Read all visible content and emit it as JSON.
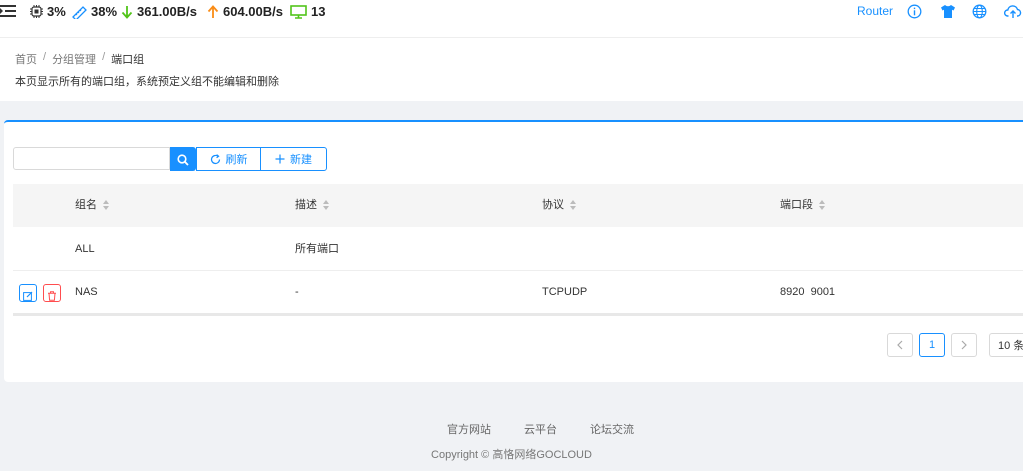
{
  "topbar": {
    "cpu": "3%",
    "mem": "38%",
    "down": "361.00B/s",
    "up": "604.00B/s",
    "clients": "13",
    "router_label": "Router"
  },
  "breadcrumb": [
    "首页",
    "分组管理",
    "端口组"
  ],
  "description": "本页显示所有的端口组，系统预定义组不能编辑和删除",
  "toolbar": {
    "search_placeholder": "",
    "refresh_label": "刷新",
    "new_label": "新建"
  },
  "table": {
    "columns": [
      "组名",
      "描述",
      "协议",
      "端口段"
    ],
    "rows": [
      {
        "name": "ALL",
        "desc": "所有端口",
        "protocol": "",
        "ports": ""
      },
      {
        "name": "NAS",
        "desc": "-",
        "protocol": "TCPUDP",
        "ports": "8920  9001"
      }
    ]
  },
  "pagination": {
    "current_page": "1",
    "page_size": "10 条"
  },
  "footer": {
    "links": [
      "官方网站",
      "云平台",
      "论坛交流"
    ],
    "copyright": "Copyright © 高恪网络GOCLOUD"
  },
  "colors": {
    "accent": "#1890ff",
    "danger": "#ff4d4f",
    "down_arrow": "#52c41a",
    "up_arrow": "#fa8c16"
  }
}
